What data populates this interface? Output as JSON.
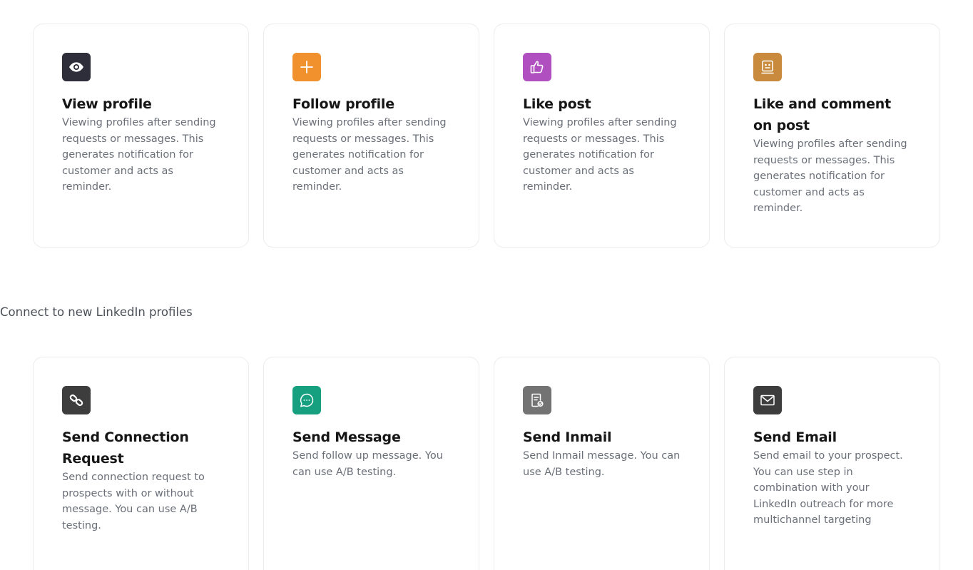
{
  "colors": {
    "view_icon_bg": "#2e2e3a",
    "follow_icon_bg": "#f0912e",
    "like_icon_bg": "#b04fc0",
    "comment_icon_bg": "#c98a3d",
    "connect_icon_bg": "#3d3d3d",
    "message_icon_bg": "#16a080",
    "inmail_icon_bg": "#737373",
    "email_icon_bg": "#3d3d3d"
  },
  "top_cards": [
    {
      "icon": "eye-icon",
      "title": "View profile",
      "description": "Viewing profiles after sending requests or messages. This generates notification for customer and acts as reminder."
    },
    {
      "icon": "plus-icon",
      "title": "Follow profile",
      "description": "Viewing profiles after sending requests or messages. This generates notification for customer and acts as reminder."
    },
    {
      "icon": "thumbs-up-icon",
      "title": "Like post",
      "description": "Viewing profiles after sending requests or messages. This generates notification for customer and acts as reminder."
    },
    {
      "icon": "comment-icon",
      "title": "Like and comment on post",
      "description": "Viewing profiles after sending requests or messages. This generates notification for customer and acts as reminder."
    }
  ],
  "section": {
    "connect_label": "Connect to new LinkedIn profiles"
  },
  "bottom_cards": [
    {
      "icon": "link-icon",
      "title": "Send Connection Request",
      "description": "Send connection request to prospects with or without message. You can use A/B testing."
    },
    {
      "icon": "chat-bubble-icon",
      "title": "Send Message",
      "description": "Send follow up message. You can use A/B testing."
    },
    {
      "icon": "inmail-icon",
      "title": "Send Inmail",
      "description": "Send Inmail message. You can use A/B testing."
    },
    {
      "icon": "envelope-icon",
      "title": "Send Email",
      "description": "Send email to your prospect. You can use step in combination with your LinkedIn outreach for more multichannel targeting"
    }
  ]
}
